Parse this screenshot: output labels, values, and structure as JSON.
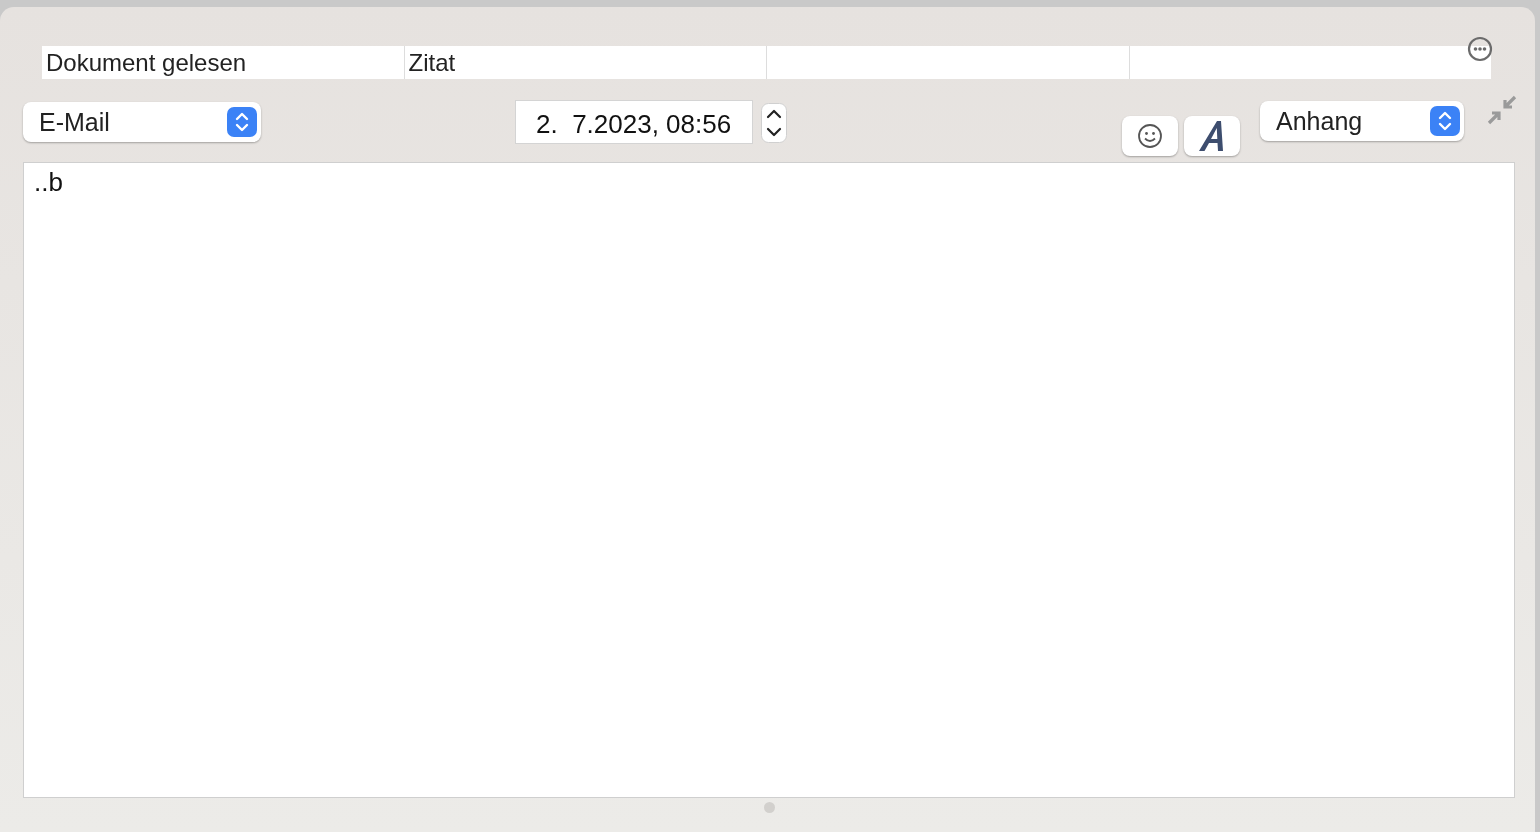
{
  "header_fields": [
    {
      "value": "Dokument gelesen"
    },
    {
      "value": "Zitat"
    }
  ],
  "type_popup": {
    "value": "E-Mail"
  },
  "date_field": {
    "value": "2.  7.2023, 08:56"
  },
  "attachment_popup": {
    "value": "Anhang"
  },
  "editor": {
    "text": "..b"
  }
}
